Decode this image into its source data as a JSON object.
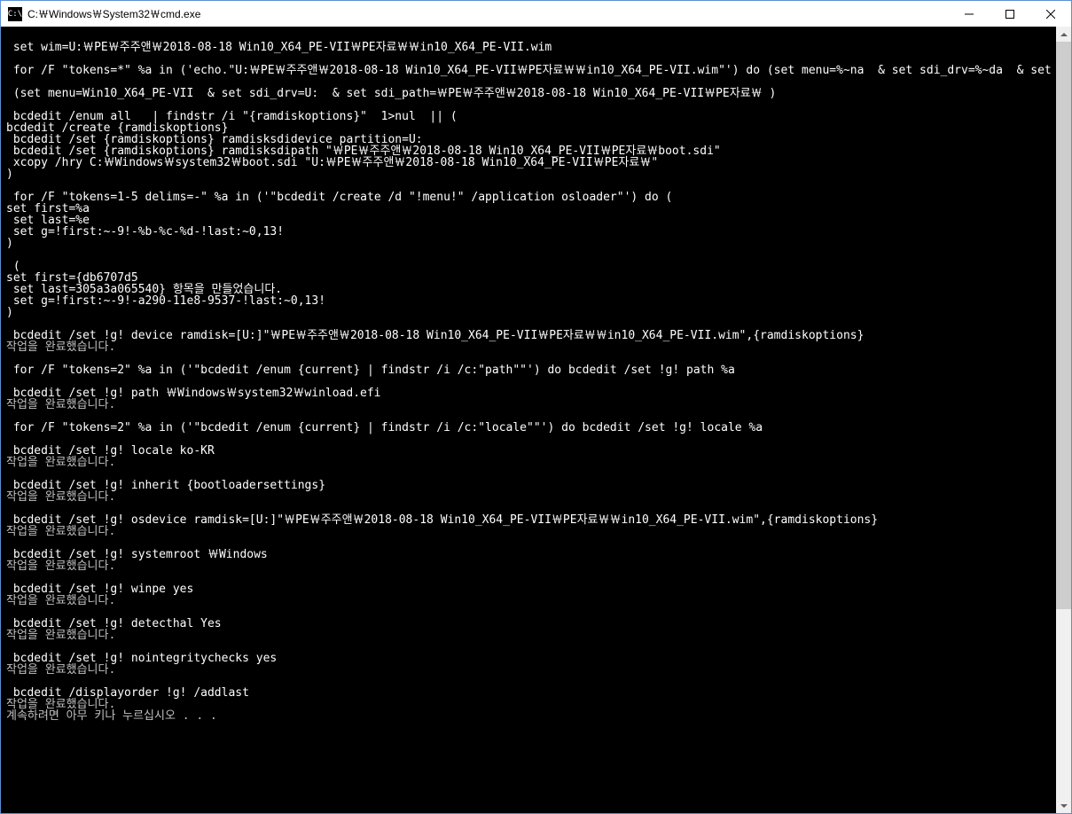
{
  "window": {
    "title": "C:￦Windows￦System32￦cmd.exe",
    "icon_label": "C:\\"
  },
  "console": {
    "lines": [
      "",
      " set wim=U:￦PE￦주주앤￦2018-08-18 Win10_X64_PE-VII￦PE자료￦￦in10_X64_PE-VII.wim",
      "",
      " for /F \"tokens=*\" %a in ('echo.\"U:￦PE￦주주앤￦2018-08-18 Win10_X64_PE-VII￦PE자료￦￦in10_X64_PE-VII.wim\"') do (set menu=%~na  & set sdi_drv=%~da  & set sdi_path=%~pa )",
      "",
      " (set menu=Win10_X64_PE-VII  & set sdi_drv=U:  & set sdi_path=￦PE￦주주앤￦2018-08-18 Win10_X64_PE-VII￦PE자료￦ )",
      "",
      " bcdedit /enum all   | findstr /i \"{ramdiskoptions}\"  1>nul  || (",
      "bcdedit /create {ramdiskoptions}",
      " bcdedit /set {ramdiskoptions} ramdisksdidevice partition=U:",
      " bcdedit /set {ramdiskoptions} ramdisksdipath \"￦PE￦주주앤￦2018-08-18 Win10_X64_PE-VII￦PE자료￦boot.sdi\"",
      " xcopy /hry C:￦Windows￦system32￦boot.sdi \"U:￦PE￦주주앤￦2018-08-18 Win10_X64_PE-VII￦PE자료￦\"",
      ")",
      "",
      " for /F \"tokens=1-5 delims=-\" %a in ('\"bcdedit /create /d \"!menu!\" /application osloader\"') do (",
      "set first=%a",
      " set last=%e",
      " set g=!first:~-9!-%b-%c-%d-!last:~0,13!",
      ")",
      "",
      " (",
      "set first={db6707d5",
      " set last=305a3a065540} 항목을 만들었습니다.",
      " set g=!first:~-9!-a290-11e8-9537-!last:~0,13!",
      ")",
      "",
      " bcdedit /set !g! device ramdisk=[U:]\"￦PE￦주주앤￦2018-08-18 Win10_X64_PE-VII￦PE자료￦￦in10_X64_PE-VII.wim\",{ramdiskoptions}",
      "작업을 완료했습니다.",
      "",
      " for /F \"tokens=2\" %a in ('\"bcdedit /enum {current} | findstr /i /c:\"path\"\"') do bcdedit /set !g! path %a",
      "",
      " bcdedit /set !g! path ￦Windows￦system32￦winload.efi",
      "작업을 완료했습니다.",
      "",
      " for /F \"tokens=2\" %a in ('\"bcdedit /enum {current} | findstr /i /c:\"locale\"\"') do bcdedit /set !g! locale %a",
      "",
      " bcdedit /set !g! locale ko-KR",
      "작업을 완료했습니다.",
      "",
      " bcdedit /set !g! inherit {bootloadersettings}",
      "작업을 완료했습니다.",
      "",
      " bcdedit /set !g! osdevice ramdisk=[U:]\"￦PE￦주주앤￦2018-08-18 Win10_X64_PE-VII￦PE자료￦￦in10_X64_PE-VII.wim\",{ramdiskoptions}",
      "작업을 완료했습니다.",
      "",
      " bcdedit /set !g! systemroot ￦Windows",
      "작업을 완료했습니다.",
      "",
      " bcdedit /set !g! winpe yes",
      "작업을 완료했습니다.",
      "",
      " bcdedit /set !g! detecthal Yes",
      "작업을 완료했습니다.",
      "",
      " bcdedit /set !g! nointegritychecks yes",
      "작업을 완료했습니다.",
      "",
      " bcdedit /displayorder !g! /addlast",
      "작업을 완료했습니다.",
      "계속하려면 아무 키나 누르십시오 . . ."
    ]
  }
}
